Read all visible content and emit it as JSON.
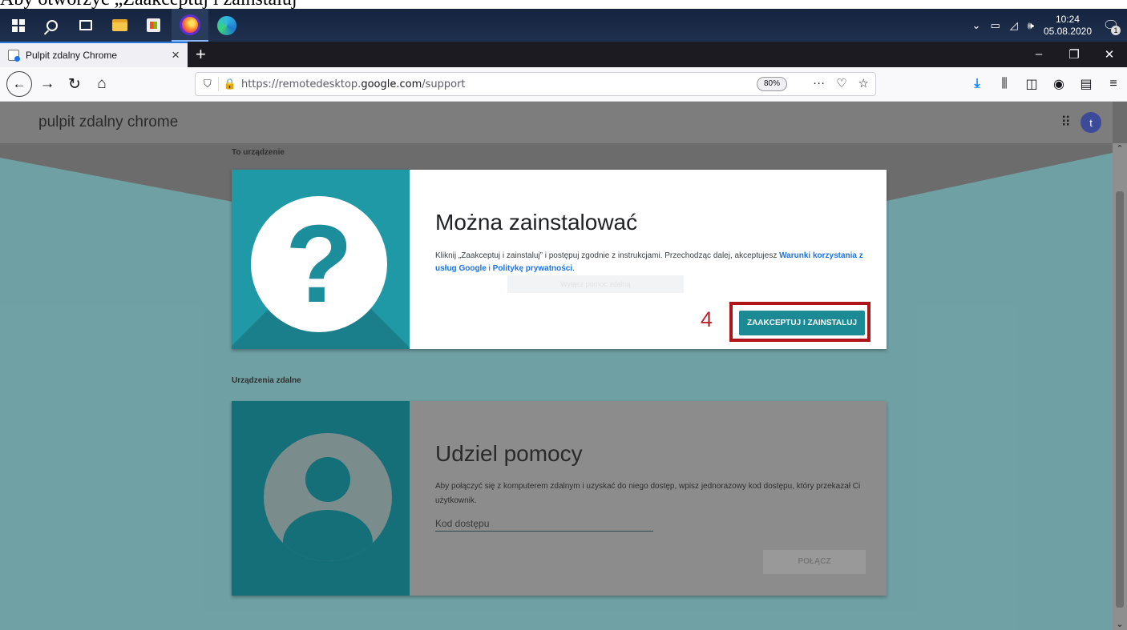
{
  "top_clip_text": "Aby otworzyć „Zaakceptuj i zainstaluj”",
  "taskbar": {
    "clock_time": "10:24",
    "clock_date": "05.08.2020",
    "notification_count": "1"
  },
  "browser": {
    "tab_title": "Pulpit zdalny Chrome",
    "url_prefix": "https://remotedesktop.",
    "url_domain": "google.com",
    "url_path": "/support",
    "zoom": "80%"
  },
  "header": {
    "brand": "pulpit zdalny chrome",
    "avatar_letter": "t"
  },
  "this_device": {
    "section_label": "To urządzenie",
    "title": "Można zainstalować",
    "desc_prefix": "Kliknij „Zaakceptuj i zainstaluj” i postępuj zgodnie z instrukcjami. Przechodząc dalej, akceptujesz ",
    "terms_link": "Warunki korzystania z usług Google",
    "desc_and": " i ",
    "privacy_link": "Politykę prywatności",
    "desc_end": ".",
    "ghost_label": "Wyłącz pomoc zdalną",
    "step_number": "4",
    "accept_label": "ZAAKCEPTUJ I ZAINSTALUJ"
  },
  "remote": {
    "section_label": "Urządzenia zdalne",
    "title": "Udziel pomocy",
    "desc": "Aby połączyć się z komputerem zdalnym i uzyskać do niego dostęp, wpisz jednorazowy kod dostępu, który przekazał Ci użytkownik.",
    "code_placeholder": "Kod dostępu",
    "connect_label": "POŁĄCZ"
  }
}
